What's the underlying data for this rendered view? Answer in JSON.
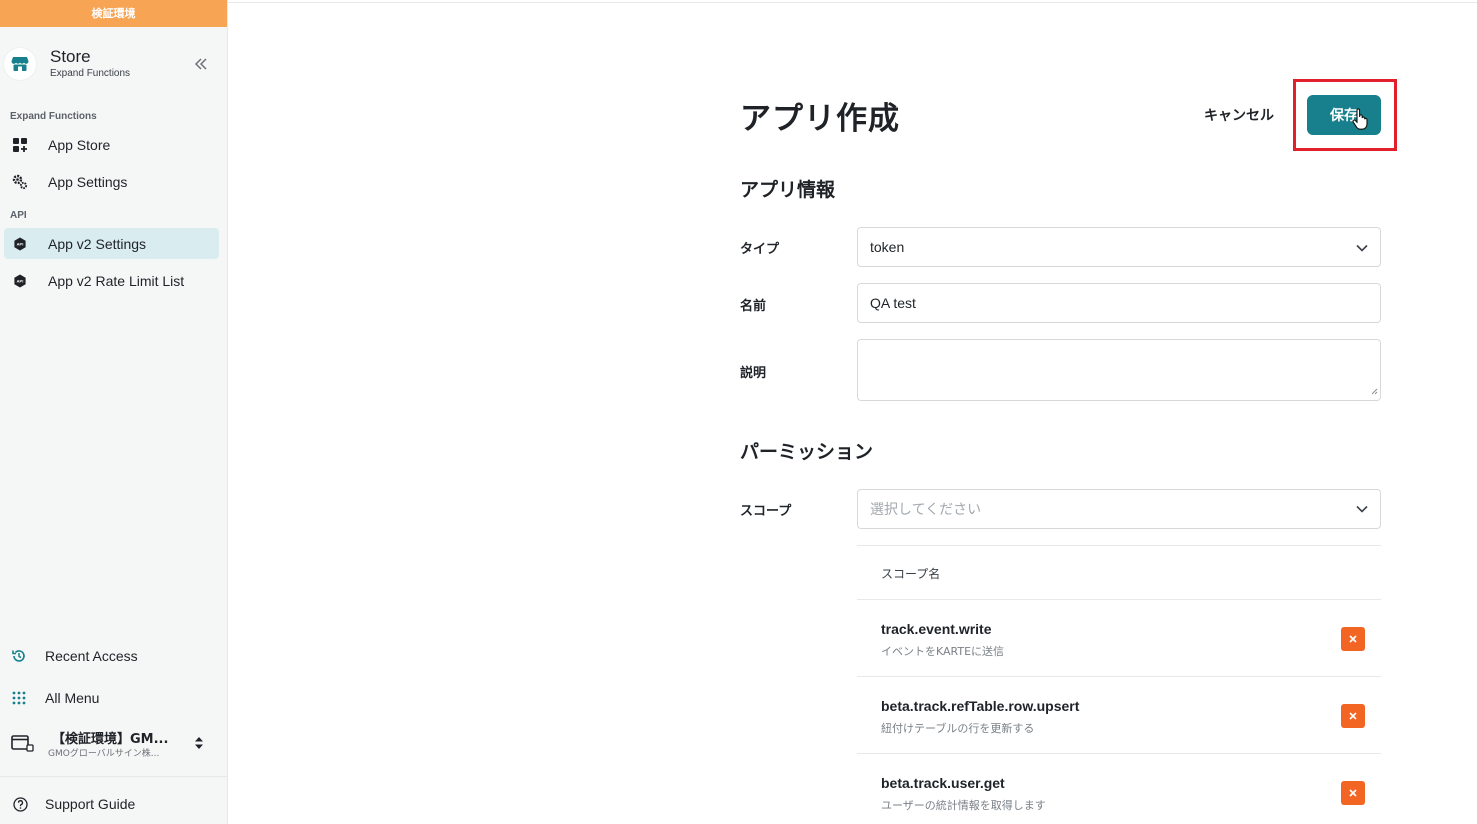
{
  "env_banner": "検証環境",
  "store": {
    "title": "Store",
    "subtitle": "Expand Functions",
    "icon": "store-icon",
    "collapse_icon": "double-chevron-left-icon"
  },
  "sidebar": {
    "section_expand": "Expand Functions",
    "section_api": "API",
    "items": [
      {
        "label": "App Store",
        "icon": "apps-grid-icon"
      },
      {
        "label": "App Settings",
        "icon": "gears-icon"
      },
      {
        "label": "App v2 Settings",
        "icon": "api-badge-icon",
        "active": true
      },
      {
        "label": "App v2 Rate Limit List",
        "icon": "api-badge-icon"
      }
    ],
    "bottom": {
      "recent": "Recent Access",
      "all_menu": "All Menu",
      "org_name": "【検証環境】GM...",
      "org_sub": "GMOグローバルサイン株...",
      "support": "Support Guide"
    }
  },
  "page": {
    "title": "アプリ作成",
    "cancel_label": "キャンセル",
    "save_label": "保存",
    "section_app_info": "アプリ情報",
    "section_permission": "パーミッション",
    "fields": {
      "type_label": "タイプ",
      "type_value": "token",
      "name_label": "名前",
      "name_value": "QA test",
      "desc_label": "説明",
      "desc_value": "",
      "scope_label": "スコープ",
      "scope_placeholder": "選択してください"
    },
    "scope_table": {
      "header": "スコープ名",
      "rows": [
        {
          "name": "track.event.write",
          "desc": "イベントをKARTEに送信"
        },
        {
          "name": "beta.track.refTable.row.upsert",
          "desc": "紐付けテーブルの行を更新する"
        },
        {
          "name": "beta.track.user.get",
          "desc": "ユーザーの統計情報を取得します"
        }
      ]
    }
  },
  "colors": {
    "accent": "#17808c",
    "banner": "#f7a454",
    "remove": "#f26522",
    "highlight": "#e0202a"
  }
}
